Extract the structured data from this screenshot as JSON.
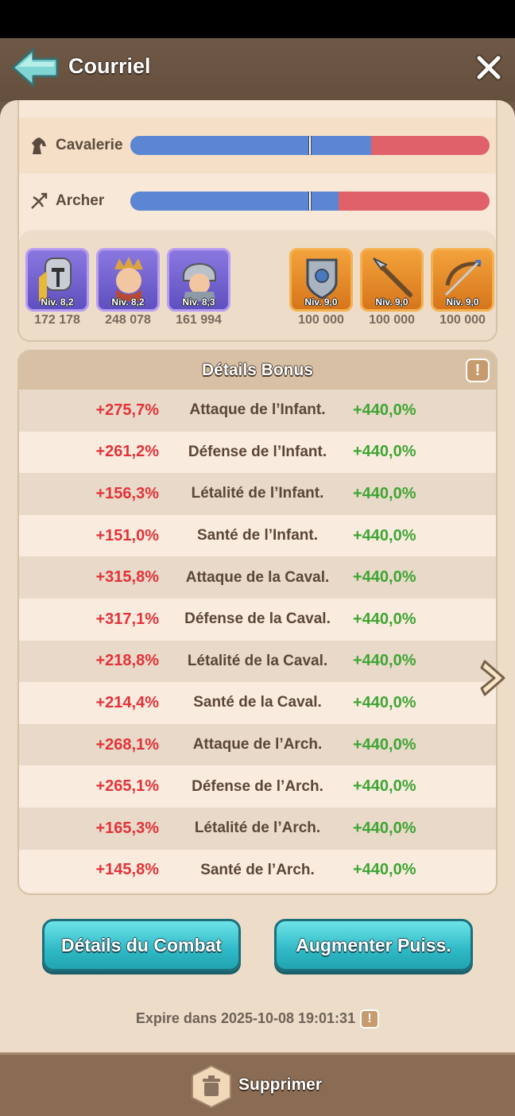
{
  "header": {
    "title": "Courriel"
  },
  "troops": [
    {
      "label": "Cavalerie",
      "icon": "horse-icon",
      "blue_fraction": 0.67,
      "marker_fraction": 0.5
    },
    {
      "label": "Archer",
      "icon": "bow-icon",
      "blue_fraction": 0.58,
      "marker_fraction": 0.5
    }
  ],
  "heroes": [
    {
      "level": "Niv. 8,2",
      "value": "172 178",
      "icon": "knight-hero-icon"
    },
    {
      "level": "Niv. 8,2",
      "value": "248 078",
      "icon": "king-hero-icon"
    },
    {
      "level": "Niv. 8,3",
      "value": "161 994",
      "icon": "warrior-hero-icon"
    }
  ],
  "equipment": [
    {
      "level": "Niv. 9,0",
      "value": "100 000",
      "icon": "shield-armor-icon"
    },
    {
      "level": "Niv. 9,0",
      "value": "100 000",
      "icon": "spear-icon"
    },
    {
      "level": "Niv. 9,0",
      "value": "100 000",
      "icon": "crossbow-icon"
    }
  ],
  "bonus": {
    "title": "Détails Bonus",
    "rows": [
      {
        "left": "+275,7%",
        "label": "Attaque de l’Infant.",
        "right": "+440,0%"
      },
      {
        "left": "+261,2%",
        "label": "Défense de l’Infant.",
        "right": "+440,0%"
      },
      {
        "left": "+156,3%",
        "label": "Létalité de l’Infant.",
        "right": "+440,0%"
      },
      {
        "left": "+151,0%",
        "label": "Santé de l’Infant.",
        "right": "+440,0%"
      },
      {
        "left": "+315,8%",
        "label": "Attaque de la Caval.",
        "right": "+440,0%"
      },
      {
        "left": "+317,1%",
        "label": "Défense de la Caval.",
        "right": "+440,0%"
      },
      {
        "left": "+218,8%",
        "label": "Létalité de la Caval.",
        "right": "+440,0%"
      },
      {
        "left": "+214,4%",
        "label": "Santé de la Caval.",
        "right": "+440,0%"
      },
      {
        "left": "+268,1%",
        "label": "Attaque de l’Arch.",
        "right": "+440,0%"
      },
      {
        "left": "+265,1%",
        "label": "Défense de l’Arch.",
        "right": "+440,0%"
      },
      {
        "left": "+165,3%",
        "label": "Létalité de l’Arch.",
        "right": "+440,0%"
      },
      {
        "left": "+145,8%",
        "label": "Santé de l’Arch.",
        "right": "+440,0%"
      }
    ]
  },
  "buttons": {
    "combat": "Détails du Combat",
    "augment": "Augmenter Puiss."
  },
  "expire": {
    "text": "Expire dans 2025-10-08 19:01:31",
    "info": "!"
  },
  "footer": {
    "delete_label": "Supprimer"
  },
  "colors": {
    "blue": "#5a86d4",
    "red": "#e0616a",
    "negative": "#e3333a",
    "positive": "#3fa534",
    "button": "#2fb9c6"
  }
}
